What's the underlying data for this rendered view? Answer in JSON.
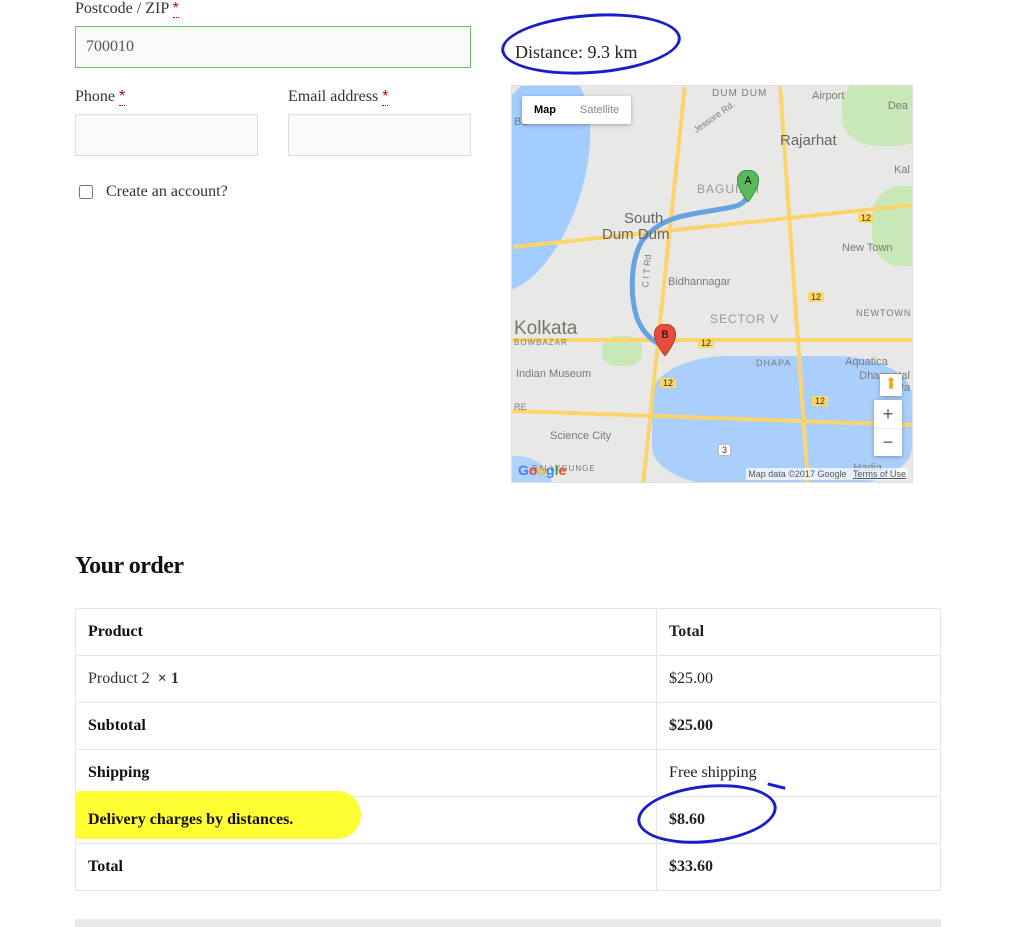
{
  "form": {
    "postcode_label": "Postcode / ZIP",
    "postcode_value": "700010",
    "phone_label": "Phone",
    "phone_value": "",
    "email_label": "Email address",
    "email_value": "",
    "create_account_label": "Create an account?",
    "create_account_checked": false,
    "required_mark": "*"
  },
  "distance": {
    "label": "Distance:",
    "value": "9.3 km"
  },
  "map": {
    "view_modes": {
      "map": "Map",
      "satellite": "Satellite"
    },
    "places": {
      "dum_dum": "DUM DUM",
      "airport": "Airport",
      "rajarhat": "Rajarhat",
      "dea": "Dea",
      "kal": "Kal",
      "baguiati": "BAGUIATI",
      "south_dum_dum_l1": "South",
      "south_dum_dum_l2": "Dum Dum",
      "bidhannagar": "Bidhannagar",
      "new_town": "New Town",
      "kolkata": "Kolkata",
      "sector_v": "SECTOR V",
      "newtown": "NEWTOWN",
      "bowbazar": "BOWBAZAR",
      "indian_museum": "Indian Museum",
      "aquatica": "Aquatica",
      "dhapa": "DHAPA",
      "dharmatala_l1": "Dharmatal",
      "dharmatala_l2": "Pa",
      "science_city": "Science City",
      "re": "RE",
      "jessore_rd": "Jessore Rd.",
      "ballygunge": "BALLYGUNGE",
      "hadia": "Hadia",
      "cit_rd": "C I T Rd",
      "ba": "Ba"
    },
    "hwy": [
      "12",
      "12",
      "12",
      "12",
      "12",
      "3"
    ],
    "markers": {
      "a": "A",
      "b": "B"
    },
    "attribution": "Map data ©2017 Google",
    "terms": "Terms of Use",
    "zoom_in": "+",
    "zoom_out": "−"
  },
  "order": {
    "heading": "Your order",
    "columns": {
      "product": "Product",
      "total": "Total"
    },
    "items": [
      {
        "name": "Product 2",
        "qty_prefix": "×",
        "qty": "1",
        "total": "$25.00"
      }
    ],
    "subtotal": {
      "label": "Subtotal",
      "value": "$25.00"
    },
    "shipping": {
      "label": "Shipping",
      "value": "Free shipping"
    },
    "delivery": {
      "label": "Delivery charges by distances.",
      "value": "$8.60"
    },
    "total": {
      "label": "Total",
      "value": "$33.60"
    }
  }
}
